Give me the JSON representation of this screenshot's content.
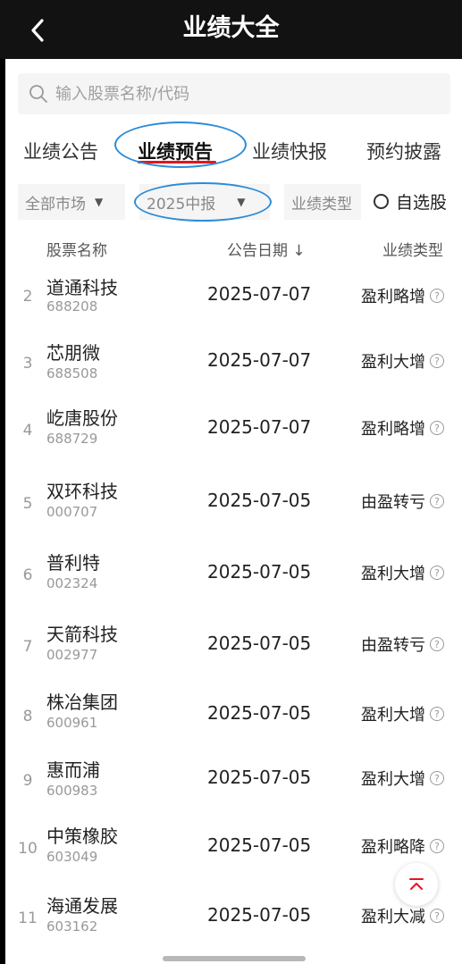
{
  "header": {
    "title": "业绩大全"
  },
  "search": {
    "placeholder": "输入股票名称/代码"
  },
  "tabs": [
    {
      "label": "业绩公告",
      "active": false
    },
    {
      "label": "业绩预告",
      "active": true
    },
    {
      "label": "业绩快报",
      "active": false
    },
    {
      "label": "预约披露",
      "active": false
    }
  ],
  "filters": {
    "market": "全部市场",
    "period": "2025中报",
    "type": "业绩类型",
    "watchlist": "自选股"
  },
  "columns": {
    "name": "股票名称",
    "date": "公告日期 ↓",
    "type": "业绩类型"
  },
  "rows": [
    {
      "idx": "2",
      "name": "道通科技",
      "code": "688208",
      "date": "2025-07-07",
      "type": "盈利略增"
    },
    {
      "idx": "3",
      "name": "芯朋微",
      "code": "688508",
      "date": "2025-07-07",
      "type": "盈利大增"
    },
    {
      "idx": "4",
      "name": "屹唐股份",
      "code": "688729",
      "date": "2025-07-07",
      "type": "盈利略增"
    },
    {
      "idx": "5",
      "name": "双环科技",
      "code": "000707",
      "date": "2025-07-05",
      "type": "由盈转亏"
    },
    {
      "idx": "6",
      "name": "普利特",
      "code": "002324",
      "date": "2025-07-05",
      "type": "盈利大增"
    },
    {
      "idx": "7",
      "name": "天箭科技",
      "code": "002977",
      "date": "2025-07-05",
      "type": "由盈转亏"
    },
    {
      "idx": "8",
      "name": "株冶集团",
      "code": "600961",
      "date": "2025-07-05",
      "type": "盈利大增"
    },
    {
      "idx": "9",
      "name": "惠而浦",
      "code": "600983",
      "date": "2025-07-05",
      "type": "盈利大增"
    },
    {
      "idx": "10",
      "name": "中策橡胶",
      "code": "603049",
      "date": "2025-07-05",
      "type": "盈利略降"
    },
    {
      "idx": "11",
      "name": "海通发展",
      "code": "603162",
      "date": "2025-07-05",
      "type": "盈利大减"
    }
  ],
  "colors": {
    "accent_red": "#e5141e",
    "annotation_blue": "#2d8cd6",
    "header_bg": "#121212"
  },
  "icons": {
    "back": "chevron-left-icon",
    "search": "search-icon",
    "help": "question-circle-icon",
    "scroll_top": "arrow-up-icon"
  }
}
